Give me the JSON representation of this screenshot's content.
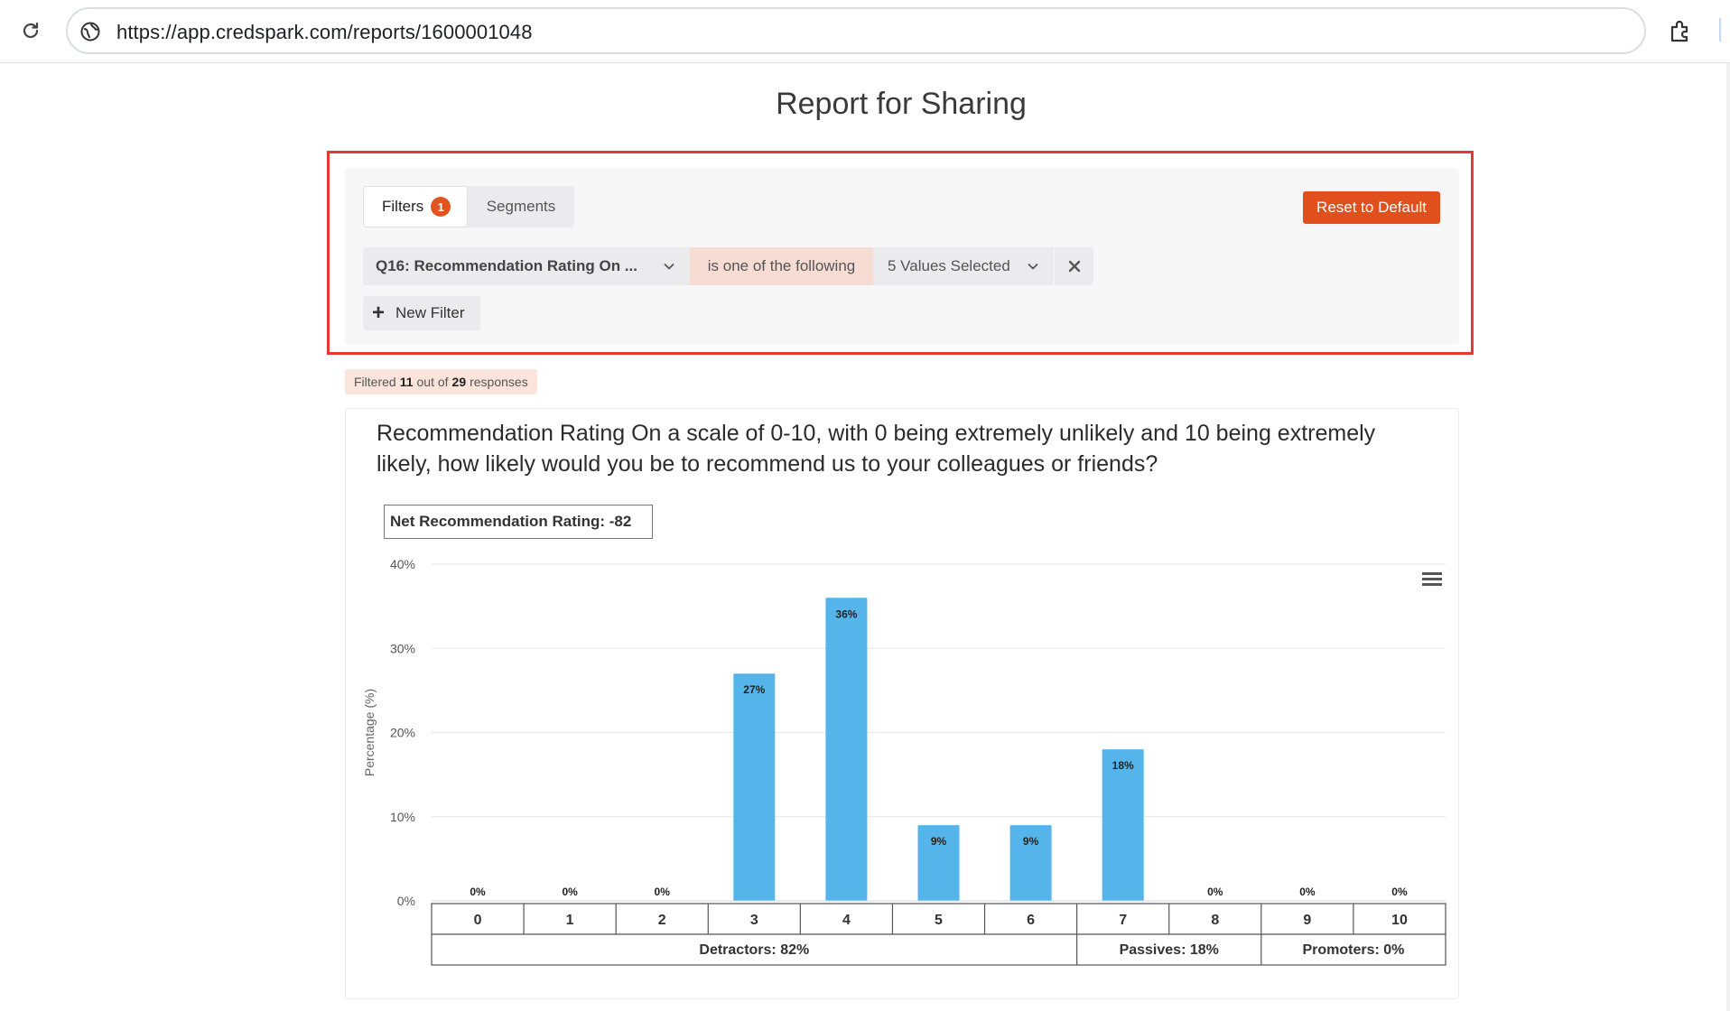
{
  "browser": {
    "url": "https://app.credspark.com/reports/1600001048"
  },
  "page": {
    "title": "Report for Sharing"
  },
  "filters": {
    "tab_filters_label": "Filters",
    "tab_filters_count": "1",
    "tab_segments_label": "Segments",
    "reset_label": "Reset to Default",
    "row": {
      "question": "Q16: Recommendation Rating On ...",
      "operator": "is one of the following",
      "values": "5 Values Selected"
    },
    "new_filter_label": "New Filter"
  },
  "summary": {
    "prefix": "Filtered",
    "filtered": "11",
    "middle": "out of",
    "total": "29",
    "suffix": "responses"
  },
  "question": {
    "text": "Recommendation Rating On a scale of 0-10, with 0 being extremely unlikely and 10 being extremely likely, how likely would you be to recommend us to your colleagues or friends?"
  },
  "nps": {
    "label": "Net Recommendation Rating: -82"
  },
  "colors": {
    "accent": "#e1501c",
    "bar": "#55b4ea",
    "frame": "#e53935"
  },
  "chart_data": {
    "type": "bar",
    "categories": [
      "0",
      "1",
      "2",
      "3",
      "4",
      "5",
      "6",
      "7",
      "8",
      "9",
      "10"
    ],
    "values": [
      0,
      0,
      0,
      27,
      36,
      9,
      9,
      18,
      0,
      0,
      0
    ],
    "data_labels": [
      "0%",
      "0%",
      "0%",
      "27%",
      "36%",
      "9%",
      "9%",
      "18%",
      "0%",
      "0%",
      "0%"
    ],
    "ylabel": "Percentage (%)",
    "ylim": [
      0,
      40
    ],
    "yticks": [
      0,
      10,
      20,
      30,
      40
    ],
    "ytick_labels": [
      "0%",
      "10%",
      "20%",
      "30%",
      "40%"
    ],
    "grid": true,
    "groups": [
      {
        "label": "Detractors: 82%",
        "from": "0",
        "to": "6"
      },
      {
        "label": "Passives: 18%",
        "from": "7",
        "to": "8"
      },
      {
        "label": "Promoters: 0%",
        "from": "9",
        "to": "10"
      }
    ]
  }
}
